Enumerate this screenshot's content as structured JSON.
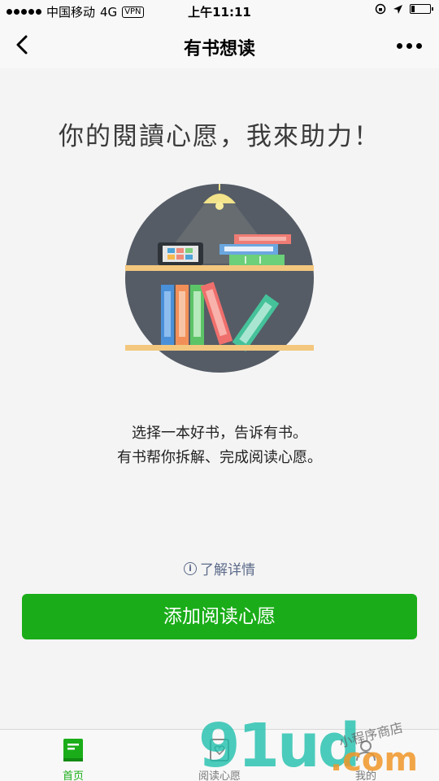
{
  "status_bar": {
    "carrier": "中国移动",
    "network": "4G",
    "vpn": "VPN",
    "time": "上午11:11",
    "battery_level": 0.2
  },
  "nav": {
    "title": "有书想读"
  },
  "main": {
    "headline": "你的閱讀心愿，我來助力！",
    "description_line1": "选择一本好书，告诉有书。",
    "description_line2": "有书帮你拆解、完成阅读心愿。",
    "learn_more": "了解详情",
    "info_glyph": "i",
    "add_button": "添加阅读心愿"
  },
  "tab_bar": {
    "tabs": [
      {
        "label": "首页",
        "active": true
      },
      {
        "label": "阅读心愿",
        "active": false
      },
      {
        "label": "我的",
        "active": false
      }
    ]
  },
  "watermark": {
    "main": "91ud",
    "suffix": ".com",
    "sub": "小程序商店"
  },
  "colors": {
    "accent": "#1aad19",
    "link": "#5c6b8a",
    "illustration_bg": "#555c66",
    "shelf": "#f3c77e"
  }
}
